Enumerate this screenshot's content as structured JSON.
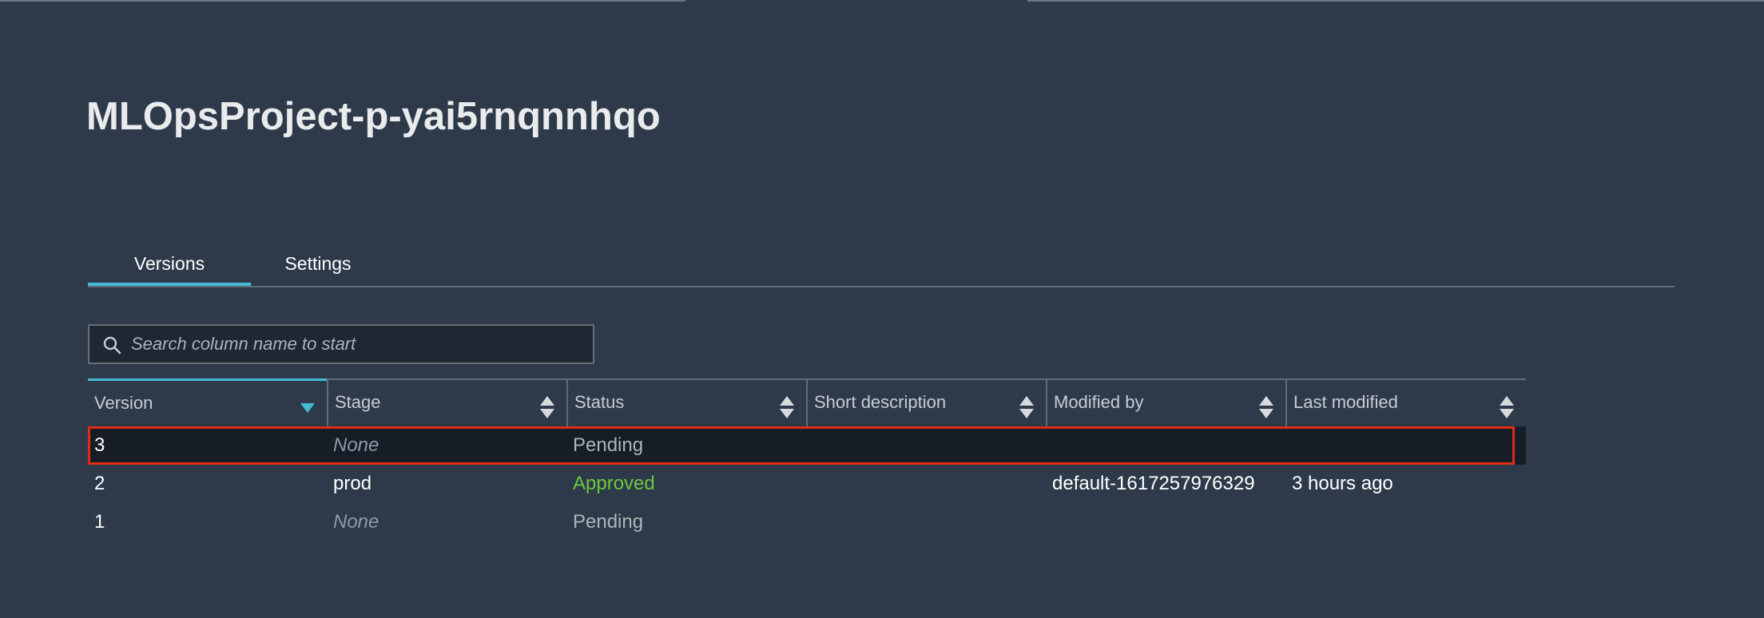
{
  "page": {
    "title": "MLOpsProject-p-yai5rnqnnhqo"
  },
  "tabs": [
    {
      "label": "Versions",
      "active": true
    },
    {
      "label": "Settings",
      "active": false
    }
  ],
  "search": {
    "placeholder": "Search column name to start",
    "value": "",
    "icon": "search-icon"
  },
  "table": {
    "columns": [
      {
        "label": "Version",
        "sort": "descending"
      },
      {
        "label": "Stage",
        "sort": "none"
      },
      {
        "label": "Status",
        "sort": "none"
      },
      {
        "label": "Short description",
        "sort": "none"
      },
      {
        "label": "Modified by",
        "sort": "none"
      },
      {
        "label": "Last modified",
        "sort": "none"
      }
    ],
    "rows": [
      {
        "version": "3",
        "stage": "None",
        "status": "Pending",
        "short_description": "",
        "modified_by": "",
        "last_modified": "",
        "selected": true
      },
      {
        "version": "2",
        "stage": "prod",
        "status": "Approved",
        "short_description": "",
        "modified_by": "default-1617257976329",
        "last_modified": "3 hours ago",
        "selected": false
      },
      {
        "version": "1",
        "stage": "None",
        "status": "Pending",
        "short_description": "",
        "modified_by": "",
        "last_modified": "",
        "selected": false
      }
    ]
  },
  "colors": {
    "background": "#2e3a4a",
    "accent": "#44b9d6",
    "approved": "#6ac93d",
    "pending": "#aab7b8",
    "selection_outline": "#e02b14"
  }
}
